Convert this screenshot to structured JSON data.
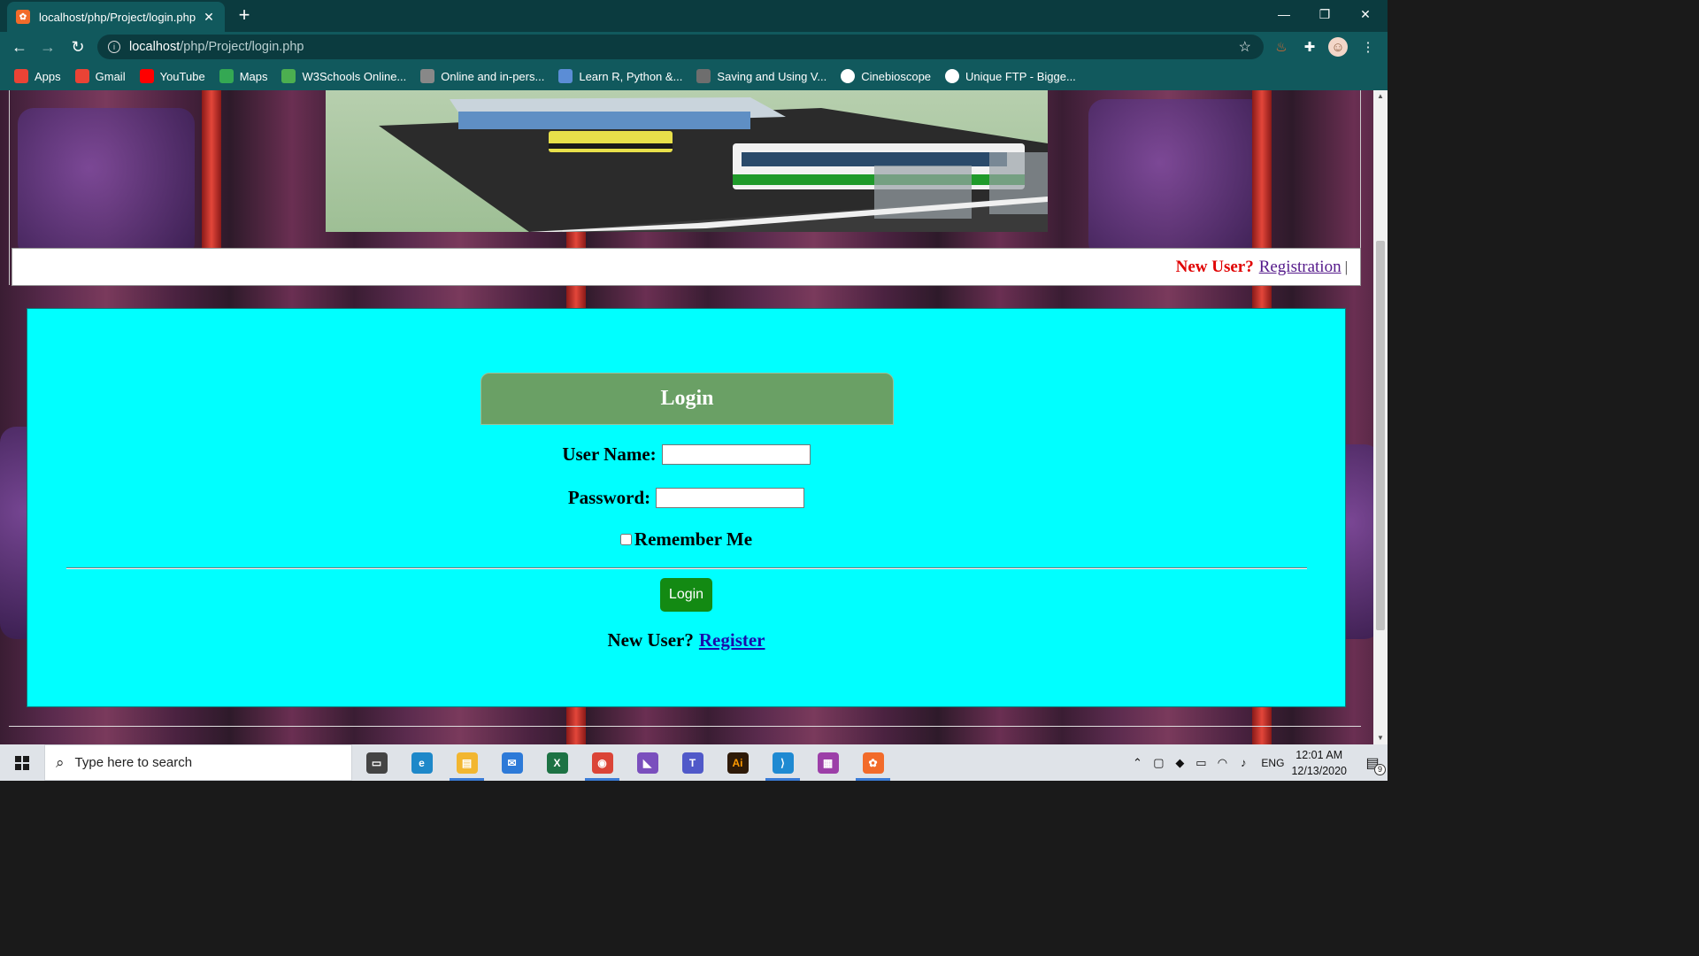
{
  "browser": {
    "tab_title": "localhost/php/Project/login.php",
    "tab_close": "✕",
    "new_tab": "+",
    "url_host": "localhost",
    "url_path": "/php/Project/login.php",
    "window_controls": {
      "minimize": "—",
      "restore": "❐",
      "close": "✕"
    },
    "bookmarks": [
      {
        "label": "Apps",
        "icon": "apps-grid-icon",
        "color": "#ea4335"
      },
      {
        "label": "Gmail",
        "icon": "gmail-icon",
        "color": "#ea4335"
      },
      {
        "label": "YouTube",
        "icon": "youtube-icon",
        "color": "#ff0000"
      },
      {
        "label": "Maps",
        "icon": "maps-icon",
        "color": "#34a853"
      },
      {
        "label": "W3Schools Online...",
        "icon": "w3schools-icon",
        "color": "#4caf50"
      },
      {
        "label": "Online and in-pers...",
        "icon": "course-icon",
        "color": "#888888"
      },
      {
        "label": "Learn R, Python &...",
        "icon": "shield-icon",
        "color": "#5b8dd6"
      },
      {
        "label": "Saving and Using V...",
        "icon": "leaf-icon",
        "color": "#6e6e6e"
      },
      {
        "label": "Cinebioscope",
        "icon": "globe-icon",
        "color": "#ffffff"
      },
      {
        "label": "Unique FTP - Bigge...",
        "icon": "globe-icon",
        "color": "#ffffff"
      }
    ]
  },
  "page": {
    "nav": {
      "new_user": "New User?",
      "registration_link": "Registration",
      "separator": "|"
    },
    "login": {
      "heading": "Login",
      "username_label": "User Name:",
      "username_value": "",
      "password_label": "Password:",
      "password_value": "",
      "remember_label": "Remember Me",
      "remember_checked": false,
      "submit_label": "Login",
      "new_user_text": "New User?",
      "register_link": "Register"
    },
    "colors": {
      "panel_bg": "#00ffff",
      "header_bg": "#6aa065",
      "button_bg": "#138a13",
      "new_user_red": "#e00000"
    }
  },
  "taskbar": {
    "search_placeholder": "Type here to search",
    "apps": [
      {
        "name": "task-view-icon",
        "label": "▭",
        "color": "#444444"
      },
      {
        "name": "edge-icon",
        "label": "e",
        "color": "#1e88c9"
      },
      {
        "name": "file-explorer-icon",
        "label": "▤",
        "color": "#f2b630"
      },
      {
        "name": "mail-icon",
        "label": "✉",
        "color": "#2d7ad8"
      },
      {
        "name": "excel-icon",
        "label": "X",
        "color": "#1d7244"
      },
      {
        "name": "chrome-icon",
        "label": "◉",
        "color": "#db4437"
      },
      {
        "name": "visual-studio-icon",
        "label": "◣",
        "color": "#7a4fbd"
      },
      {
        "name": "teams-icon",
        "label": "T",
        "color": "#5059c9"
      },
      {
        "name": "illustrator-icon",
        "label": "Ai",
        "color": "#2e1a08"
      },
      {
        "name": "vscode-icon",
        "label": "⟩",
        "color": "#1f8ad2"
      },
      {
        "name": "winrar-icon",
        "label": "▦",
        "color": "#9c3fa8"
      },
      {
        "name": "xampp-icon",
        "label": "✿",
        "color": "#f26b2a"
      }
    ],
    "tray": {
      "lang": "ENG",
      "time": "12:01 AM",
      "date": "12/13/2020",
      "notifications": "9"
    }
  }
}
